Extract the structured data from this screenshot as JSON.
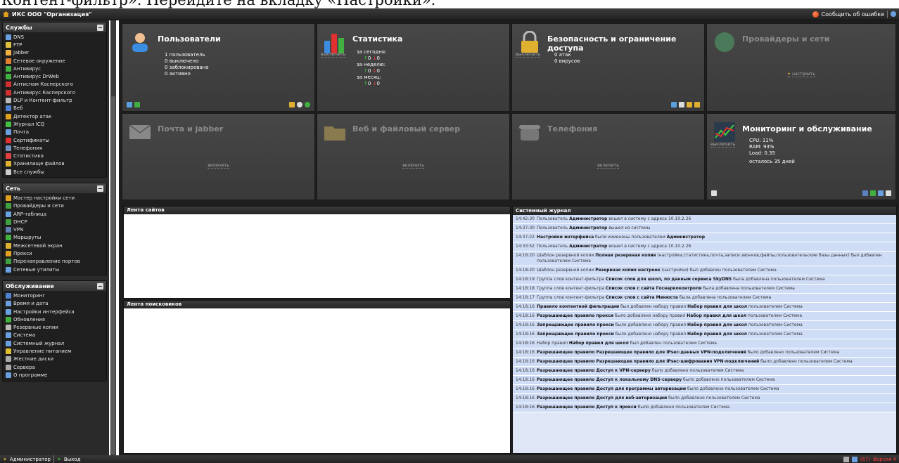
{
  "doc_strip": "Контент-фильтр». Перейдите на вкладку «Настройки».",
  "header": {
    "org": "ИКС ООО \"Организация\"",
    "report_error": "Сообщить об ошибке"
  },
  "sidebar": {
    "services": {
      "title": "Службы",
      "items": [
        {
          "label": "DNS",
          "color": "#6aa0e0"
        },
        {
          "label": "FTP",
          "color": "#e0c040"
        },
        {
          "label": "Jabber",
          "color": "#f0b040"
        },
        {
          "label": "Сетевое окружение",
          "color": "#e08030"
        },
        {
          "label": "Антивирус",
          "color": "#40b040"
        },
        {
          "label": "Антивирус DrWeb",
          "color": "#40b040"
        },
        {
          "label": "Антиспам Касперского",
          "color": "#d03030"
        },
        {
          "label": "Антивирус Касперского",
          "color": "#d03030"
        },
        {
          "label": "DLP и Контент-фильтр",
          "color": "#bbbbbb"
        },
        {
          "label": "Веб",
          "color": "#5080d0"
        },
        {
          "label": "Детектор атак",
          "color": "#e0a020"
        },
        {
          "label": "Журнал ICQ",
          "color": "#40c040"
        },
        {
          "label": "Почта",
          "color": "#6aa0e0"
        },
        {
          "label": "Сертификаты",
          "color": "#e03030"
        },
        {
          "label": "Телефония",
          "color": "#7090c0"
        },
        {
          "label": "Статистика",
          "color": "#e04040"
        },
        {
          "label": "Хранилище файлов",
          "color": "#e0b030"
        },
        {
          "label": "Все службы",
          "color": "#cccccc"
        }
      ]
    },
    "network": {
      "title": "Сеть",
      "items": [
        {
          "label": "Мастер настройки сети",
          "color": "#e0a020"
        },
        {
          "label": "Провайдеры и сети",
          "color": "#40a040"
        },
        {
          "label": "ARP-таблица",
          "color": "#6aa0e0"
        },
        {
          "label": "DHCP",
          "color": "#40a040"
        },
        {
          "label": "VPN",
          "color": "#6080b0"
        },
        {
          "label": "Маршруты",
          "color": "#40b040"
        },
        {
          "label": "Межсетевой экран",
          "color": "#e0b030"
        },
        {
          "label": "Прокси",
          "color": "#e0a020"
        },
        {
          "label": "Перенаправление портов",
          "color": "#40a040"
        },
        {
          "label": "Сетевые утилиты",
          "color": "#6aa0e0"
        }
      ]
    },
    "maintenance": {
      "title": "Обслуживание",
      "items": [
        {
          "label": "Мониторинг",
          "color": "#5080d0"
        },
        {
          "label": "Время и дата",
          "color": "#6aa0e0"
        },
        {
          "label": "Настройки интерфейса",
          "color": "#6aa0e0"
        },
        {
          "label": "Обновления",
          "color": "#40b040"
        },
        {
          "label": "Резервные копии",
          "color": "#bbbbbb"
        },
        {
          "label": "Система",
          "color": "#6aa0e0"
        },
        {
          "label": "Системный журнал",
          "color": "#6aa0e0"
        },
        {
          "label": "Управление питанием",
          "color": "#e0c030"
        },
        {
          "label": "Жесткие диски",
          "color": "#aaaaaa"
        },
        {
          "label": "Сервера",
          "color": "#aaaaaa"
        },
        {
          "label": "О программе",
          "color": "#6aa0e0"
        }
      ]
    }
  },
  "tiles": {
    "users": {
      "title": "Пользователи",
      "lines": [
        "1 пользователь",
        "0 выключено",
        "0 заблокировано",
        "0 активно"
      ]
    },
    "stats": {
      "title": "Статистика",
      "action": "выключить",
      "today": "за сегодня:",
      "week": "за неделю:",
      "month": "за месяц:",
      "in": "0",
      "out": "0"
    },
    "security": {
      "title": "Безопасность и ограничение доступа",
      "action": "выключить",
      "lines": [
        "0 атак",
        "0 вирусов"
      ]
    },
    "providers": {
      "title": "Провайдеры и сети",
      "configure": "настроить"
    },
    "mail": {
      "title": "Почта и jabber",
      "enable": "включить"
    },
    "web": {
      "title": "Веб и файловый сервер",
      "enable": "включить"
    },
    "telephony": {
      "title": "Телефония",
      "enable": "включить"
    },
    "monitoring": {
      "title": "Мониторинг и обслуживание",
      "action": "выключить",
      "lines": [
        "CPU: 11%",
        "RAM: 93%",
        "Load: 0.35"
      ],
      "remaining": "осталось 35 дней"
    }
  },
  "feeds": {
    "sites": "Лента сайтов",
    "search": "Лента поисковиков"
  },
  "log": {
    "title": "Системный журнал",
    "rows": [
      {
        "time": "14:42:30",
        "html": "Пользователь <b>Администратор</b> вошел в систему с адреса 10.10.2.26"
      },
      {
        "time": "14:37:30",
        "html": "Пользователь <b>Администратор</b> вышел из системы"
      },
      {
        "time": "14:37:22",
        "html": "<b>Настройки интерфейса</b> были изменены пользователем <b>Администратор</b>"
      },
      {
        "time": "14:33:52",
        "html": "Пользователь <b>Администратор</b> вошел в систему с адреса 10.10.2.26"
      },
      {
        "time": "14:18:20",
        "html": "Шаблон резервной копии <b>Полная резервная копия</b> (настройки,статистика,почта,записи звонков,файлы,пользовательские базы данных) был добавлен пользователем Система"
      },
      {
        "time": "14:18:20",
        "html": "Шаблон резервной копии <b>Резервная копия настроек</b> (настройки) был добавлен пользователем Система"
      },
      {
        "time": "14:18:19",
        "html": "Группа слов контент-фильтра <b>Список слов для школ, по данным сервиса SkyDNS</b> была добавлена пользователем Система"
      },
      {
        "time": "14:18:18",
        "html": "Группа слов контент-фильтра <b>Список слов с сайта Госнаркоконтроля</b> была добавлена пользователем Система"
      },
      {
        "time": "14:18:17",
        "html": "Группа слов контент-фильтра <b>Список слов с сайта Минюста</b> была добавлена пользователем Система"
      },
      {
        "time": "14:18:16",
        "html": "<b>Правило контентной фильтрации</b> был добавлен набору правил <b>Набор правил для школ</b> пользователем Система"
      },
      {
        "time": "14:18:16",
        "html": "<b>Разрешающее правило прокси</b> было добавлено набору правил <b>Набор правил для школ</b> пользователем Система"
      },
      {
        "time": "14:18:16",
        "html": "<b>Запрещающее правило прокси</b> было добавлено набору правил <b>Набор правил для школ</b> пользователем Система"
      },
      {
        "time": "14:18:16",
        "html": "<b>Запрещающее правило прокси</b> было добавлено набору правил <b>Набор правил для школ</b> пользователем Система"
      },
      {
        "time": "14:18:16",
        "html": "Набор правил <b>Набор правил для школ</b> был добавлен пользователем Система"
      },
      {
        "time": "14:18:16",
        "html": "<b>Разрешающее правило Разрешающее правило для IPsec-данных VPN-подключений</b> было добавлено пользователем Система"
      },
      {
        "time": "14:18:16",
        "html": "<b>Разрешающее правило Разрешающее правило для IPsec-шифрования VPN-подключений</b> было добавлено пользователем Система"
      },
      {
        "time": "14:18:16",
        "html": "<b>Разрешающее правило Доступ к VPN-серверу</b> было добавлено пользователем Система"
      },
      {
        "time": "14:18:16",
        "html": "<b>Разрешающее правило Доступ к локальному DNS-серверу</b> было добавлено пользователем Система"
      },
      {
        "time": "14:18:16",
        "html": "<b>Разрешающее правило Доступ для программы авторизации</b> было добавлено пользователем Система"
      },
      {
        "time": "14:18:16",
        "html": "<b>Разрешающее правило Доступ для веб-авторизации</b> было добавлено пользователем Система"
      },
      {
        "time": "14:18:16",
        "html": "<b>Разрешающее правило Доступ к прокси</b> было добавлено пользователем Система"
      }
    ]
  },
  "footer": {
    "user": "Администратор",
    "logout": "Выход",
    "count": "(67)",
    "version": "Версия 4"
  }
}
